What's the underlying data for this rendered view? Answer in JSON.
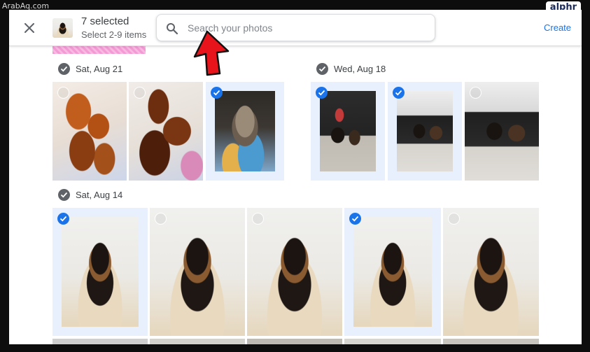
{
  "watermarks": {
    "left": "ArabAq.com",
    "right": "alphr"
  },
  "header": {
    "selected_count": "7 selected",
    "selection_hint": "Select 2-9 items",
    "search_placeholder": "Search your photos",
    "create_label": "Create"
  },
  "sections": [
    {
      "date": "Sat, Aug 21"
    },
    {
      "date": "Wed, Aug 18"
    },
    {
      "date": "Sat, Aug 14"
    }
  ],
  "icons": {
    "close": "close-icon",
    "search": "search-icon",
    "check": "check-icon",
    "arrow": "red-arrow-annotation"
  },
  "photos": {
    "aug21": [
      {
        "subject": "food",
        "selected": false
      },
      {
        "subject": "food",
        "selected": false
      },
      {
        "subject": "dog",
        "selected": true
      }
    ],
    "aug18": [
      {
        "subject": "dogs-on-chair",
        "selected": true
      },
      {
        "subject": "dogs-on-chair",
        "selected": true
      },
      {
        "subject": "dogs-on-chair",
        "selected": false
      }
    ],
    "aug14": [
      {
        "subject": "puppy",
        "selected": true
      },
      {
        "subject": "puppy",
        "selected": false
      },
      {
        "subject": "puppy",
        "selected": false
      },
      {
        "subject": "puppy",
        "selected": true
      },
      {
        "subject": "puppy",
        "selected": false
      }
    ]
  },
  "colors": {
    "accent": "#1a73e8",
    "selected_bg": "#e8f0fe",
    "arrow": "#e8141b"
  }
}
